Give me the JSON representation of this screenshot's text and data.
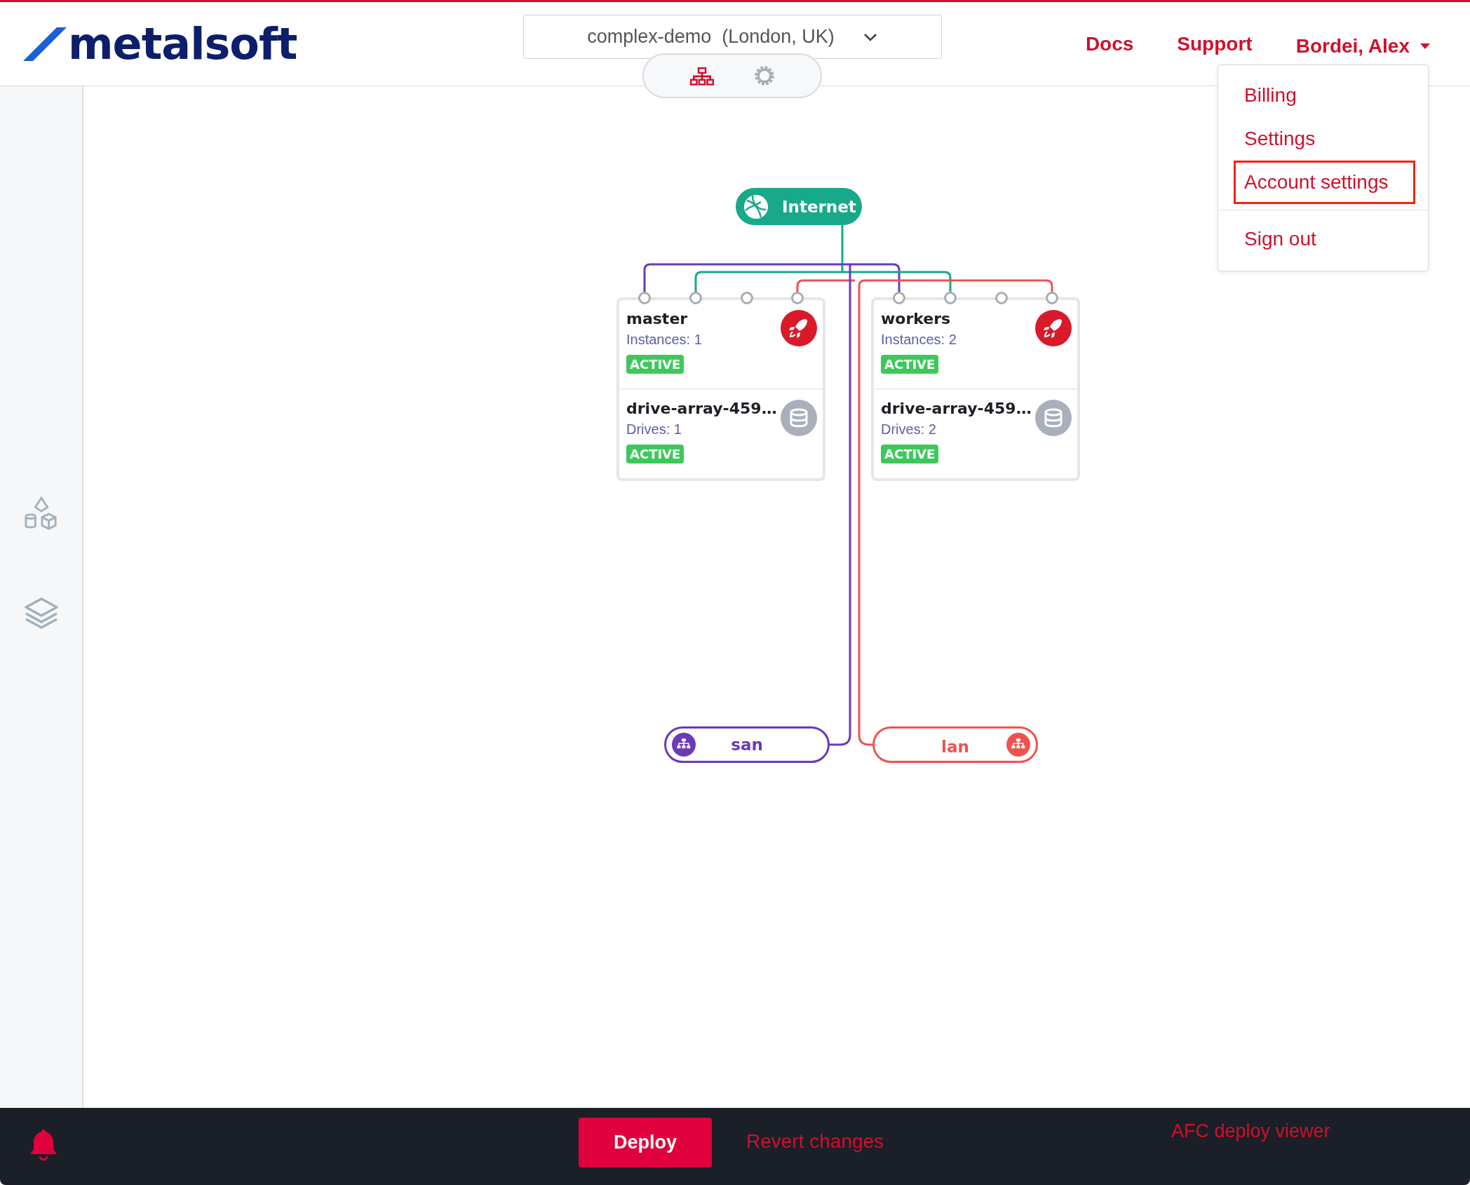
{
  "header": {
    "logo": "metalsoft",
    "infrastructure_select": "complex-demo  (London, UK)",
    "links": [
      {
        "label": "Docs"
      },
      {
        "label": "Support"
      }
    ],
    "user": {
      "label": "Bordei, Alex",
      "expanded": true
    }
  },
  "user_menu": [
    {
      "label": "Billing",
      "selected": false
    },
    {
      "label": "Settings",
      "selected": false
    },
    {
      "label": "Account settings",
      "selected": true
    },
    {
      "label": "Sign out",
      "selected": false
    }
  ],
  "view_tabs": [
    {
      "kind": "topology",
      "selected": true
    },
    {
      "kind": "settings",
      "selected": false
    }
  ],
  "sidebar": [
    {
      "kind": "shapes"
    },
    {
      "kind": "layers"
    }
  ],
  "networks": [
    {
      "name": "Internet",
      "kind": "internet",
      "color": "#17a98a"
    },
    {
      "name": "san",
      "kind": "san",
      "color": "#6a3ab8"
    },
    {
      "name": "lan",
      "kind": "lan",
      "color": "#ee5350"
    }
  ],
  "instance_arrays": [
    {
      "title": "master",
      "subtitle": "Instances: 1",
      "status": "ACTIVE",
      "drive": {
        "title": "drive-array-459…",
        "subtitle": "Drives: 1",
        "status": "ACTIVE"
      }
    },
    {
      "title": "workers",
      "subtitle": "Instances: 2",
      "status": "ACTIVE",
      "drive": {
        "title": "drive-array-459…",
        "subtitle": "Drives: 2",
        "status": "ACTIVE"
      }
    }
  ],
  "footer": {
    "deploy": "Deploy",
    "revert": "Revert changes",
    "viewer": "AFC deploy viewer"
  }
}
